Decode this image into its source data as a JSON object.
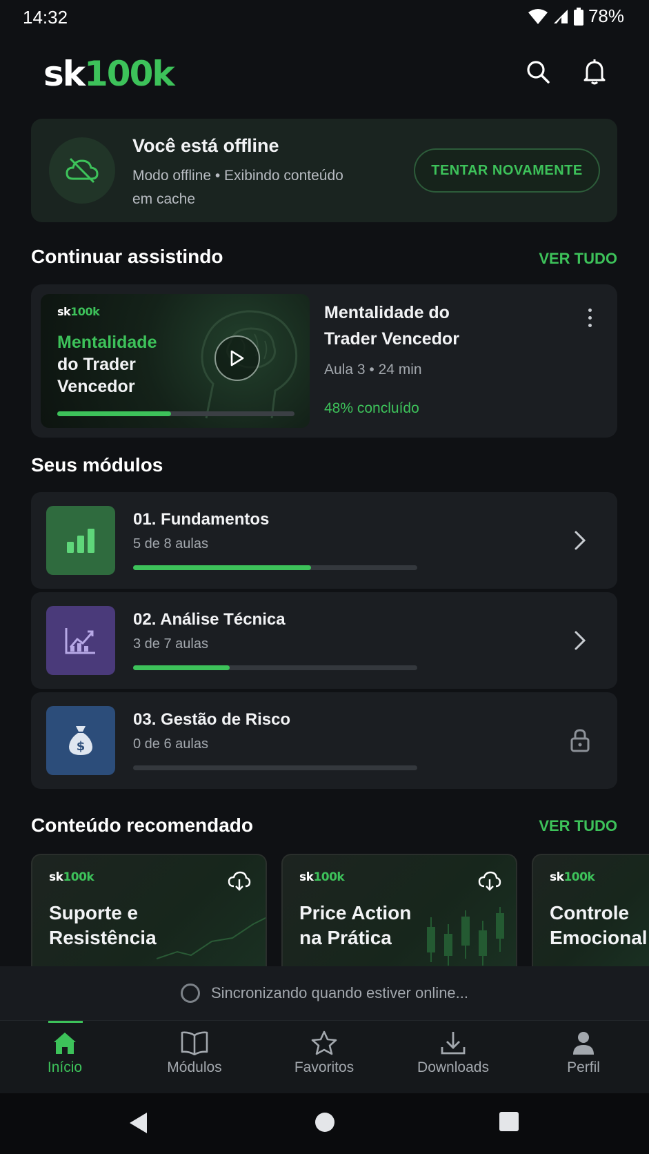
{
  "status_bar": {
    "time": "14:32",
    "battery": "78%"
  },
  "header": {
    "logo_prefix": "sk",
    "logo_suffix": "100k",
    "search_icon": "search-icon",
    "bell_icon": "bell-icon"
  },
  "offline": {
    "title": "Você está offline",
    "subtitle": "Modo offline • Exibindo conteúdo em cache",
    "retry_label": "TENTAR NOVAMENTE"
  },
  "continue": {
    "section_title": "Continuar assistindo",
    "see_all": "VER TUDO",
    "thumb_logo_prefix": "sk",
    "thumb_logo_suffix": "100k",
    "thumb_title_green": "Mentalidade",
    "thumb_title_line2": "do Trader",
    "thumb_title_line3": "Vencedor",
    "title": "Mentalidade do Trader Vencedor",
    "meta": "Aula 3 • 24 min",
    "progress_text": "48% concluído",
    "progress": 0.48
  },
  "modules": {
    "section_title": "Seus módulos",
    "items": [
      {
        "name": "01. Fundamentos",
        "sub": "5 de 8 aulas",
        "progress": 0.625,
        "icon": "bar-chart-icon",
        "color": "#2f6b3e",
        "state": "chevron-right-icon"
      },
      {
        "name": "02. Análise Técnica",
        "sub": "3 de 7 aulas",
        "progress": 0.34,
        "icon": "line-chart-icon",
        "color": "#4a3a7a",
        "state": "chevron-right-icon"
      },
      {
        "name": "03. Gestão de Risco",
        "sub": "0 de 6 aulas",
        "progress": 0,
        "icon": "money-bag-icon",
        "color": "#2c4d7a",
        "state": "lock-icon"
      }
    ]
  },
  "recommended": {
    "section_title": "Conteúdo recomendado",
    "see_all": "VER TUDO",
    "logo_prefix": "sk",
    "logo_suffix": "100k",
    "items": [
      {
        "title_line1": "Suporte e",
        "title_line2": "Resistência"
      },
      {
        "title_line1": "Price Action",
        "title_line2": "na Prática"
      },
      {
        "title_line1": "Controle",
        "title_line2": "Emocional"
      }
    ]
  },
  "sync": {
    "text": "Sincronizando quando estiver online..."
  },
  "bottom_nav": {
    "items": [
      {
        "label": "Início",
        "icon": "home-icon",
        "active": true
      },
      {
        "label": "Módulos",
        "icon": "book-icon",
        "active": false
      },
      {
        "label": "Favoritos",
        "icon": "star-icon",
        "active": false
      },
      {
        "label": "Downloads",
        "icon": "download-icon",
        "active": false
      },
      {
        "label": "Perfil",
        "icon": "user-icon",
        "active": false
      }
    ]
  },
  "colors": {
    "accent": "#3dc25a",
    "background": "#0f1114",
    "card": "#1b1e22"
  }
}
